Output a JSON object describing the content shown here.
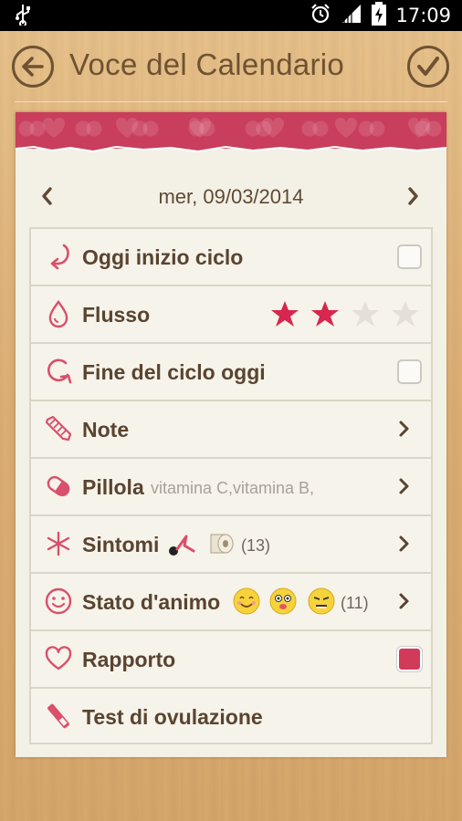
{
  "status_bar": {
    "time": "17:09",
    "icons": [
      "usb-icon",
      "alarm-icon",
      "signal-icon",
      "battery-charging-icon"
    ]
  },
  "header": {
    "title": "Voce del Calendario",
    "back_icon": "arrow-left-icon",
    "confirm_icon": "checkmark-icon"
  },
  "date_nav": {
    "date": "mer, 09/03/2014",
    "prev_icon": "chevron-left-icon",
    "next_icon": "chevron-right-icon"
  },
  "rows": [
    {
      "label": "Oggi inizio ciclo",
      "icon": "cycle-start-arrow-icon",
      "checked": false
    },
    {
      "label": "Flusso",
      "icon": "drop-icon",
      "rating": 2,
      "max_rating": 5
    },
    {
      "label": "Fine del ciclo oggi",
      "icon": "cycle-end-icon",
      "checked": false
    },
    {
      "label": "Note",
      "icon": "pencil-icon"
    },
    {
      "label": "Pillola",
      "icon": "pill-icon",
      "detail": "vitamina C,vitamina B,"
    },
    {
      "label": "Sintomi",
      "icon": "asterisk-icon",
      "count": "(13)",
      "symptom_icons": [
        "pain-icon",
        "toilet-paper-icon"
      ]
    },
    {
      "label": "Stato d'animo",
      "icon": "smiley-icon",
      "count": "(11)",
      "mood_icons": [
        "happy-face-icon",
        "silly-face-icon",
        "annoyed-face-icon"
      ]
    },
    {
      "label": "Rapporto",
      "icon": "heart-icon",
      "checked": true
    },
    {
      "label": "Test di ovulazione",
      "icon": "ovulation-test-icon"
    }
  ],
  "colors": {
    "accent": "#d23a5a",
    "text_brown": "#5a4430",
    "header_brown": "#6f5232",
    "paper": "#f3f0e6"
  }
}
